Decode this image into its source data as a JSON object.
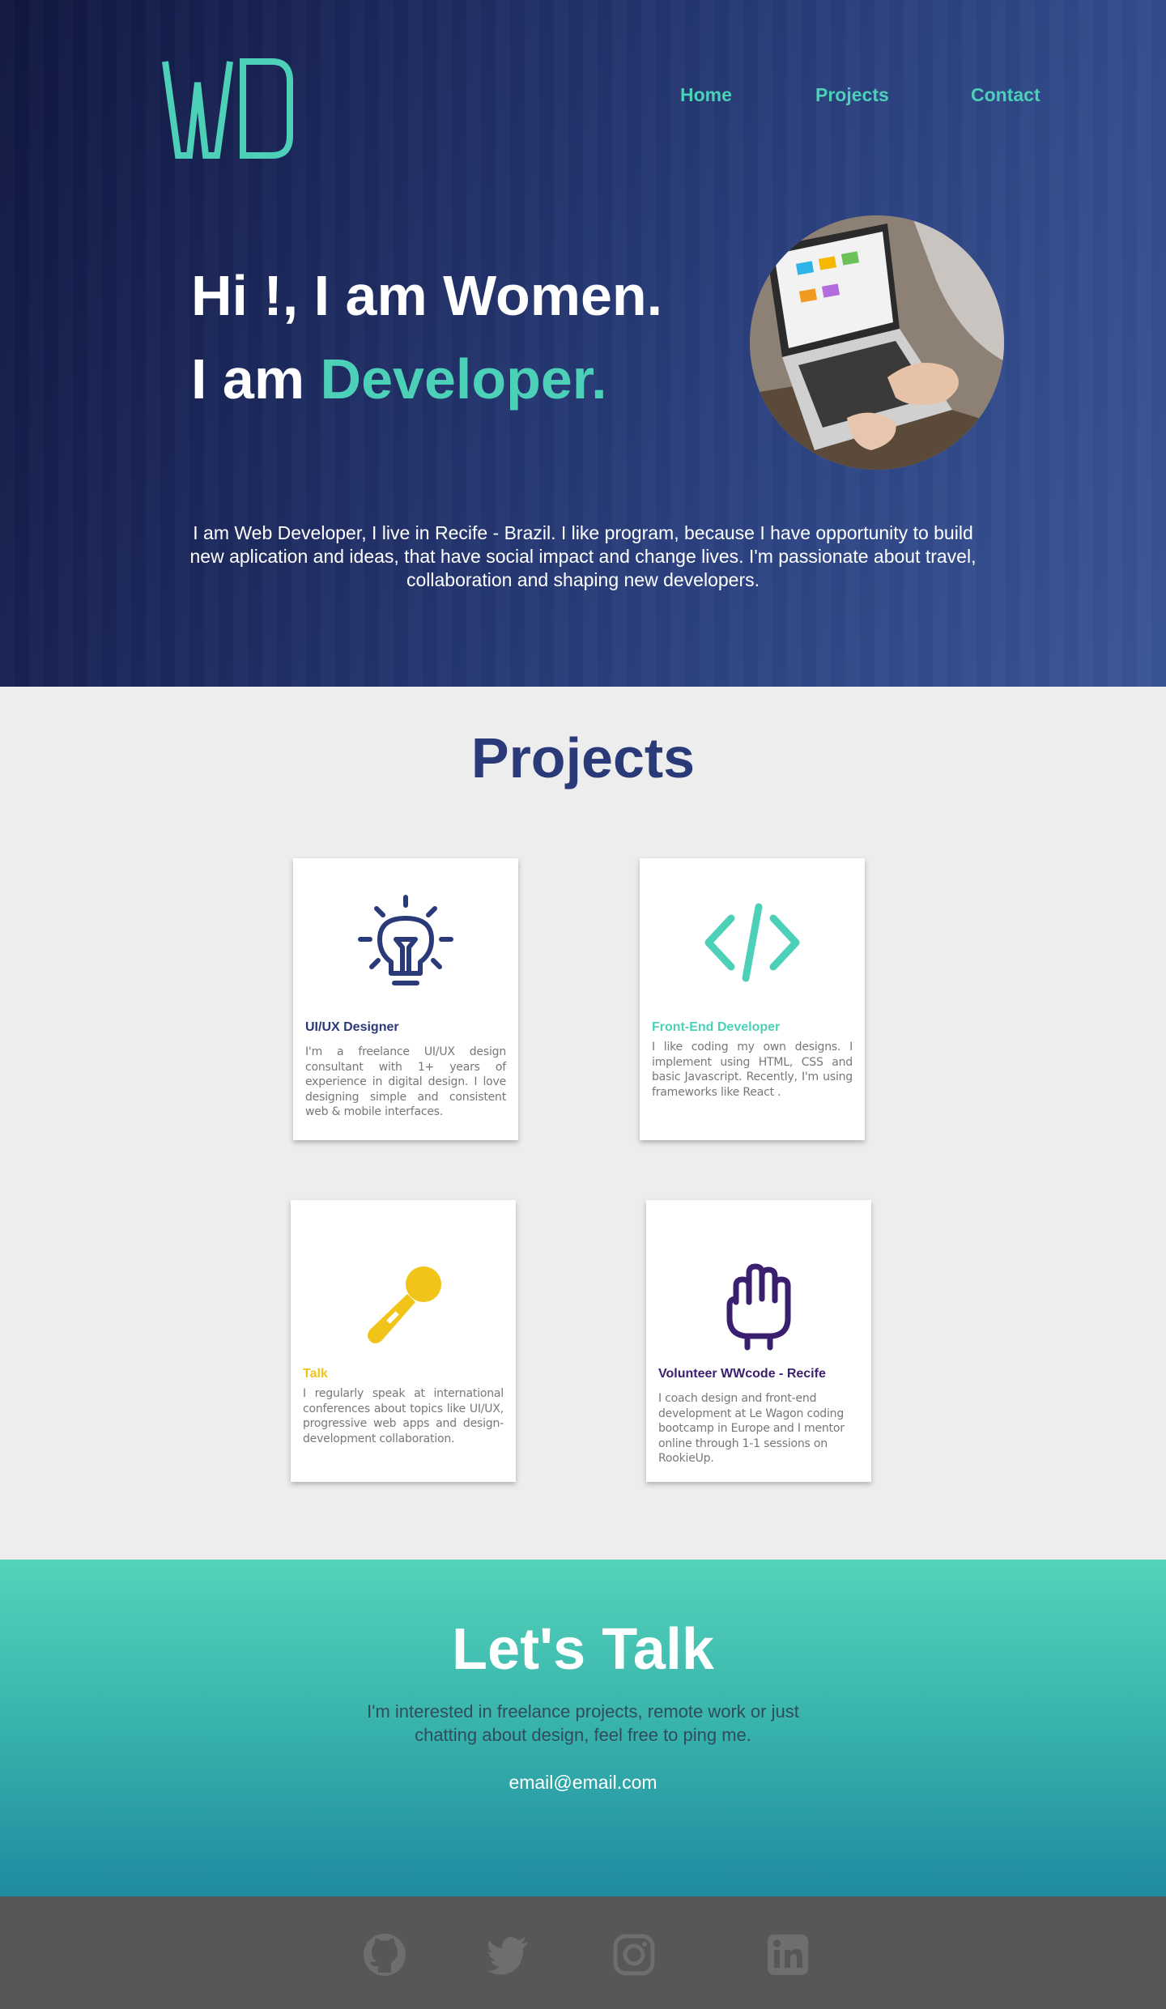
{
  "brand": {
    "logo_text": "WD"
  },
  "nav": {
    "home": "Home",
    "projects": "Projects",
    "contact": "Contact"
  },
  "hero": {
    "line1": "Hi !, I am Women.",
    "line2_prefix": "I am ",
    "line2_accent": "Developer.",
    "intro": "I am Web Developer, I live in Recife - Brazil. I like  program, because  I have opportunity to build new aplication and ideas, that have social impact and change lives. I'm passionate about travel, collaboration and shaping new developers."
  },
  "projects": {
    "title": "Projects",
    "cards": [
      {
        "icon": "lightbulb-icon",
        "title": "UI/UX Designer",
        "color": "#2a3a78",
        "desc": "I'm a freelance UI/UX design consultant with 1+ years of experience in digital design. I love designing simple and consistent web & mobile interfaces."
      },
      {
        "icon": "code-icon",
        "title": "Front-End Developer",
        "color": "#4dd0b8",
        "desc": "I like coding my own designs. I implement using HTML, CSS and basic Javascript. Recently, I'm using frameworks like React ."
      },
      {
        "icon": "microphone-icon",
        "title": "Talk",
        "color": "#f0c419",
        "desc": "I regularly speak at international conferences about topics like UI/UX, progressive web apps and design-development collaboration."
      },
      {
        "icon": "raised-hand-icon",
        "title": "Volunteer WWcode - Recife",
        "color": "#3a1f6e",
        "desc": "I coach design and front-end development at Le Wagon coding bootcamp in Europe and I mentor online through 1-1 sessions on RookieUp."
      }
    ]
  },
  "talk": {
    "title": "Let's Talk",
    "text": "I'm interested in freelance projects, remote work or just chatting about design, feel free to ping me.",
    "email": "email@email.com"
  },
  "footer": {
    "icons": [
      "github-icon",
      "twitter-icon",
      "instagram-icon",
      "linkedin-icon"
    ]
  },
  "colors": {
    "accent": "#4dd0b8",
    "navy": "#2a3a78",
    "footer": "#575757"
  }
}
